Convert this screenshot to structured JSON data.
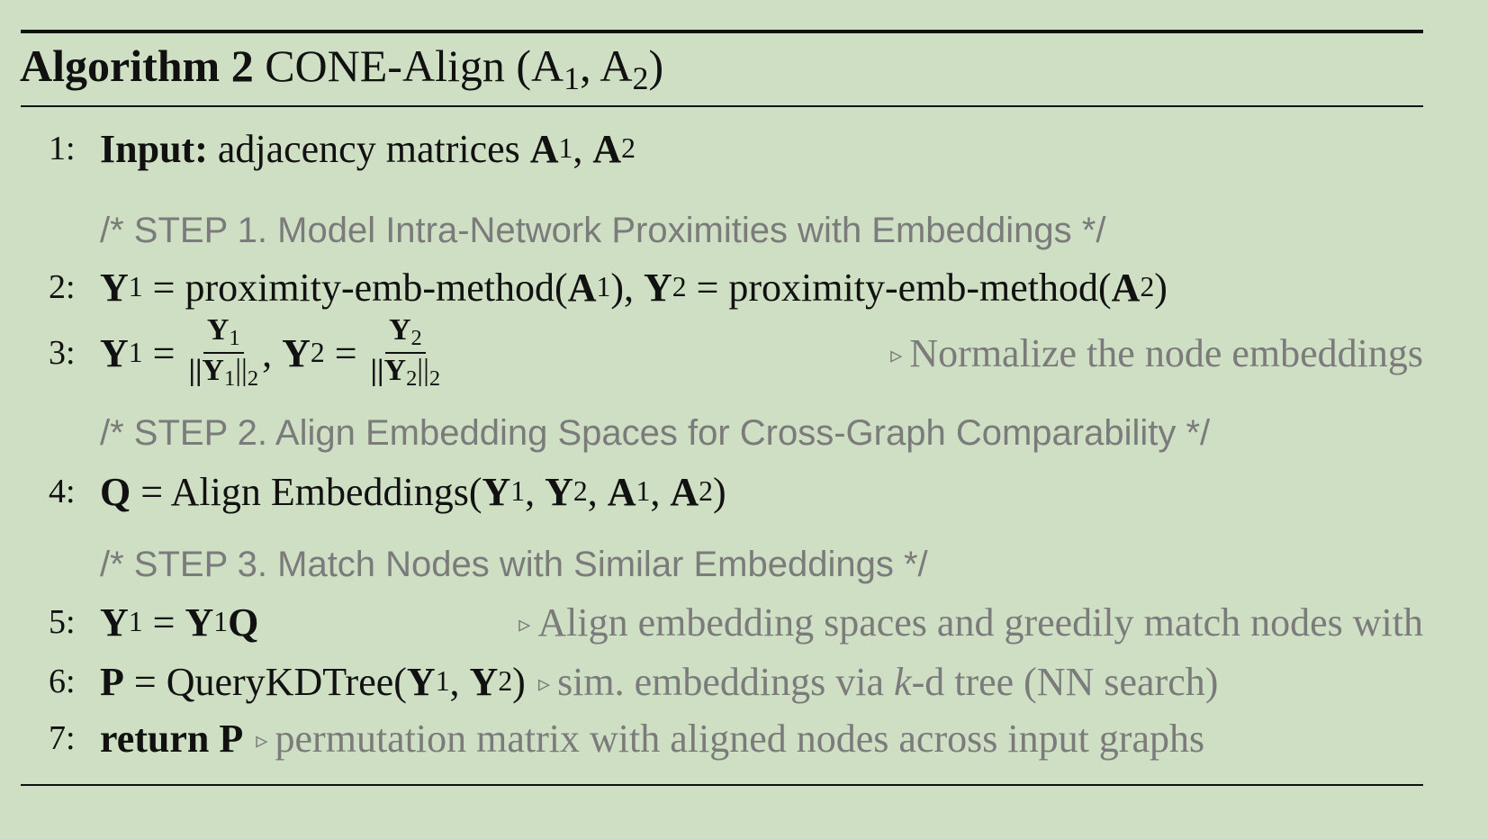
{
  "header": {
    "label": "Algorithm 2",
    "name": [
      {
        "k": "t",
        "v": " CONE-Align ("
      },
      {
        "k": "t",
        "v": "A"
      },
      {
        "k": "s",
        "v": "1"
      },
      {
        "k": "t",
        "v": ", "
      },
      {
        "k": "t",
        "v": "A"
      },
      {
        "k": "s",
        "v": "2"
      },
      {
        "k": "t",
        "v": ")"
      }
    ]
  },
  "lines": [
    {
      "num": "1:",
      "code": [
        {
          "k": "b",
          "v": "Input:"
        },
        {
          "k": "t",
          "v": " adjacency matrices "
        },
        {
          "k": "b",
          "v": "A"
        },
        {
          "k": "s",
          "v": "1"
        },
        {
          "k": "t",
          "v": ", "
        },
        {
          "k": "b",
          "v": "A"
        },
        {
          "k": "s",
          "v": "2"
        }
      ]
    },
    {
      "step": "/* STEP 1. Model Intra-Network Proximities with Embeddings */"
    },
    {
      "num": "2:",
      "code": [
        {
          "k": "b",
          "v": "Y"
        },
        {
          "k": "s",
          "v": "1"
        },
        {
          "k": "t",
          "v": " = proximity-emb-method("
        },
        {
          "k": "b",
          "v": "A"
        },
        {
          "k": "s",
          "v": "1"
        },
        {
          "k": "t",
          "v": "), "
        },
        {
          "k": "b",
          "v": "Y"
        },
        {
          "k": "s",
          "v": "2"
        },
        {
          "k": "t",
          "v": " = proximity-emb-method("
        },
        {
          "k": "b",
          "v": "A"
        },
        {
          "k": "s",
          "v": "2"
        },
        {
          "k": "t",
          "v": ")"
        }
      ]
    },
    {
      "num": "3:",
      "code": [
        {
          "k": "b",
          "v": "Y"
        },
        {
          "k": "s",
          "v": "1"
        },
        {
          "k": "t",
          "v": " = "
        },
        {
          "k": "frac",
          "num": "Y",
          "numsub": "1",
          "den": "||Y",
          "densub": "1",
          "den2": "||",
          "den2sub": "2"
        },
        {
          "k": "t",
          "v": ", "
        },
        {
          "k": "b",
          "v": "Y"
        },
        {
          "k": "s",
          "v": "2"
        },
        {
          "k": "t",
          "v": " = "
        },
        {
          "k": "frac",
          "num": "Y",
          "numsub": "2",
          "den": "||Y",
          "densub": "2",
          "den2": "||",
          "den2sub": "2"
        }
      ],
      "comment": [
        {
          "k": "c",
          "v": "Normalize the node embeddings"
        }
      ],
      "align": "right"
    },
    {
      "step": "/* STEP 2. Align Embedding Spaces for Cross-Graph Comparability */"
    },
    {
      "num": "4:",
      "code": [
        {
          "k": "b",
          "v": "Q"
        },
        {
          "k": "t",
          "v": " = Align Embeddings("
        },
        {
          "k": "b",
          "v": "Y"
        },
        {
          "k": "s",
          "v": "1"
        },
        {
          "k": "t",
          "v": ", "
        },
        {
          "k": "b",
          "v": "Y"
        },
        {
          "k": "s",
          "v": "2"
        },
        {
          "k": "t",
          "v": ", "
        },
        {
          "k": "b",
          "v": "A"
        },
        {
          "k": "s",
          "v": "1"
        },
        {
          "k": "t",
          "v": ", "
        },
        {
          "k": "b",
          "v": "A"
        },
        {
          "k": "s",
          "v": "2"
        },
        {
          "k": "t",
          "v": ")"
        }
      ]
    },
    {
      "step": "/* STEP 3. Match Nodes with Similar Embeddings */"
    },
    {
      "num": "5:",
      "code": [
        {
          "k": "b",
          "v": "Y"
        },
        {
          "k": "s",
          "v": "1"
        },
        {
          "k": "t",
          "v": " = "
        },
        {
          "k": "b",
          "v": "Y"
        },
        {
          "k": "s",
          "v": "1"
        },
        {
          "k": "b",
          "v": "Q"
        }
      ],
      "comment": [
        {
          "k": "c",
          "v": "Align embedding spaces and greedily match nodes with"
        }
      ],
      "align": "right"
    },
    {
      "num": "6:",
      "code": [
        {
          "k": "b",
          "v": "P"
        },
        {
          "k": "t",
          "v": " = QueryKDTree("
        },
        {
          "k": "b",
          "v": "Y"
        },
        {
          "k": "s",
          "v": "1"
        },
        {
          "k": "t",
          "v": ", "
        },
        {
          "k": "b",
          "v": "Y"
        },
        {
          "k": "s",
          "v": "2"
        },
        {
          "k": "t",
          "v": ")"
        }
      ],
      "comment": [
        {
          "k": "c",
          "v": "sim. embeddings via "
        },
        {
          "k": "ci",
          "v": "k"
        },
        {
          "k": "c",
          "v": "-d tree (NN search)"
        }
      ],
      "align": "left"
    },
    {
      "num": "7:",
      "code": [
        {
          "k": "b",
          "v": "return"
        },
        {
          "k": "t",
          "v": " "
        },
        {
          "k": "b",
          "v": "P"
        }
      ],
      "comment": [
        {
          "k": "c",
          "v": "permutation matrix with aligned nodes across input graphs"
        }
      ],
      "align": "left"
    }
  ],
  "comment_marker": "▹",
  "colors": {
    "background": "#cfdfc4",
    "comment": "#7b7b7b",
    "text": "#111111"
  }
}
